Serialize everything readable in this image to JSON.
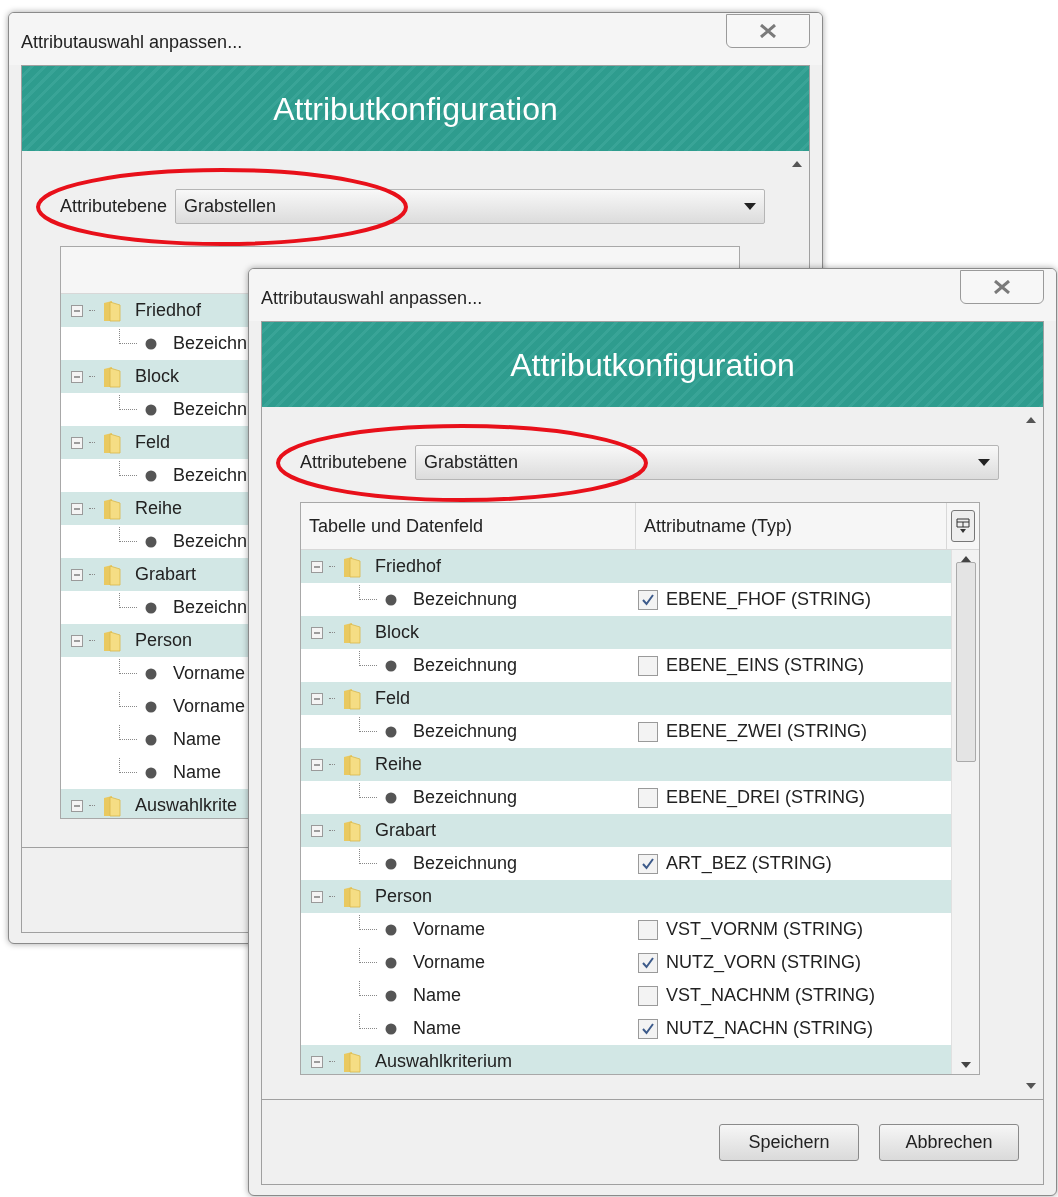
{
  "windows": [
    {
      "title": "Attributauswahl anpassen...",
      "banner": "Attributkonfiguration",
      "level_label": "Attributebene",
      "level_value": "Grabstellen",
      "highlighted": true,
      "rows": [
        {
          "label": "Friedhof",
          "expanded": true,
          "children": [
            {
              "label": "Bezeichn"
            }
          ]
        },
        {
          "label": "Block",
          "expanded": true,
          "children": [
            {
              "label": "Bezeichn"
            }
          ]
        },
        {
          "label": "Feld",
          "expanded": true,
          "children": [
            {
              "label": "Bezeichn"
            }
          ]
        },
        {
          "label": "Reihe",
          "expanded": true,
          "children": [
            {
              "label": "Bezeichn"
            }
          ]
        },
        {
          "label": "Grabart",
          "expanded": true,
          "children": [
            {
              "label": "Bezeichn"
            }
          ]
        },
        {
          "label": "Person",
          "expanded": true,
          "children": [
            {
              "label": "Vorname"
            },
            {
              "label": "Vorname"
            },
            {
              "label": "Name"
            },
            {
              "label": "Name"
            }
          ]
        },
        {
          "label": "Auswahlkrite",
          "expanded": true,
          "children": []
        }
      ]
    },
    {
      "title": "Attributauswahl anpassen...",
      "banner": "Attributkonfiguration",
      "level_label": "Attributebene",
      "level_value": "Grabstätten",
      "highlighted": true,
      "columns": [
        "Tabelle und Datenfeld",
        "Attributname (Typ)"
      ],
      "buttons": [
        "Speichern",
        "Abbrechen"
      ],
      "rows": [
        {
          "label": "Friedhof",
          "expanded": true,
          "children": [
            {
              "label": "Bezeichnung",
              "attribute": "EBENE_FHOF (STRING)",
              "checked": true
            }
          ]
        },
        {
          "label": "Block",
          "expanded": true,
          "children": [
            {
              "label": "Bezeichnung",
              "attribute": "EBENE_EINS (STRING)",
              "checked": false
            }
          ]
        },
        {
          "label": "Feld",
          "expanded": true,
          "children": [
            {
              "label": "Bezeichnung",
              "attribute": "EBENE_ZWEI (STRING)",
              "checked": false
            }
          ]
        },
        {
          "label": "Reihe",
          "expanded": true,
          "children": [
            {
              "label": "Bezeichnung",
              "attribute": "EBENE_DREI (STRING)",
              "checked": false
            }
          ]
        },
        {
          "label": "Grabart",
          "expanded": true,
          "children": [
            {
              "label": "Bezeichnung",
              "attribute": "ART_BEZ (STRING)",
              "checked": true
            }
          ]
        },
        {
          "label": "Person",
          "expanded": true,
          "children": [
            {
              "label": "Vorname",
              "attribute": "VST_VORNM (STRING)",
              "checked": false
            },
            {
              "label": "Vorname",
              "attribute": "NUTZ_VORN (STRING)",
              "checked": true
            },
            {
              "label": "Name",
              "attribute": "VST_NACHNM (STRING)",
              "checked": false
            },
            {
              "label": "Name",
              "attribute": "NUTZ_NACHN (STRING)",
              "checked": true
            }
          ]
        },
        {
          "label": "Auswahlkriterium",
          "expanded": true,
          "children": []
        }
      ]
    }
  ]
}
